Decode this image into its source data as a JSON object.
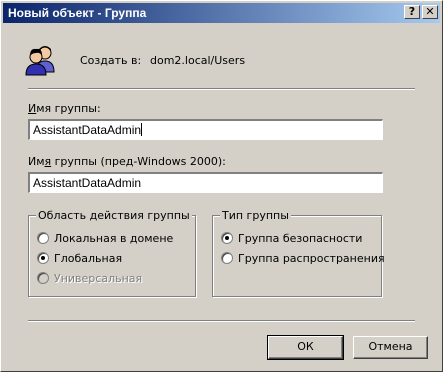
{
  "window": {
    "title": "Новый объект - Группа",
    "help_glyph": "?",
    "close_glyph": "✕"
  },
  "header": {
    "create_in_label": "Создать в:",
    "create_in_value": "dom2.local/Users"
  },
  "fields": {
    "group_name_label": "Имя группы:",
    "group_name_value": "AssistantDataAdmin",
    "group_name_pre2000_label": "Имя группы (пред-Windows 2000):",
    "group_name_pre2000_value": "AssistantDataAdmin"
  },
  "scope": {
    "title": "Область действия группы",
    "options": [
      {
        "label": "Локальная в домене",
        "checked": false,
        "disabled": false
      },
      {
        "label": "Глобальная",
        "checked": true,
        "disabled": false
      },
      {
        "label": "Универсальная",
        "checked": false,
        "disabled": true
      }
    ]
  },
  "type": {
    "title": "Тип группы",
    "options": [
      {
        "label": "Группа безопасности",
        "checked": true
      },
      {
        "label": "Группа распространения",
        "checked": false
      }
    ]
  },
  "buttons": {
    "ok": "ОК",
    "cancel": "Отмена"
  },
  "icons": {
    "group": "users-group-icon"
  }
}
